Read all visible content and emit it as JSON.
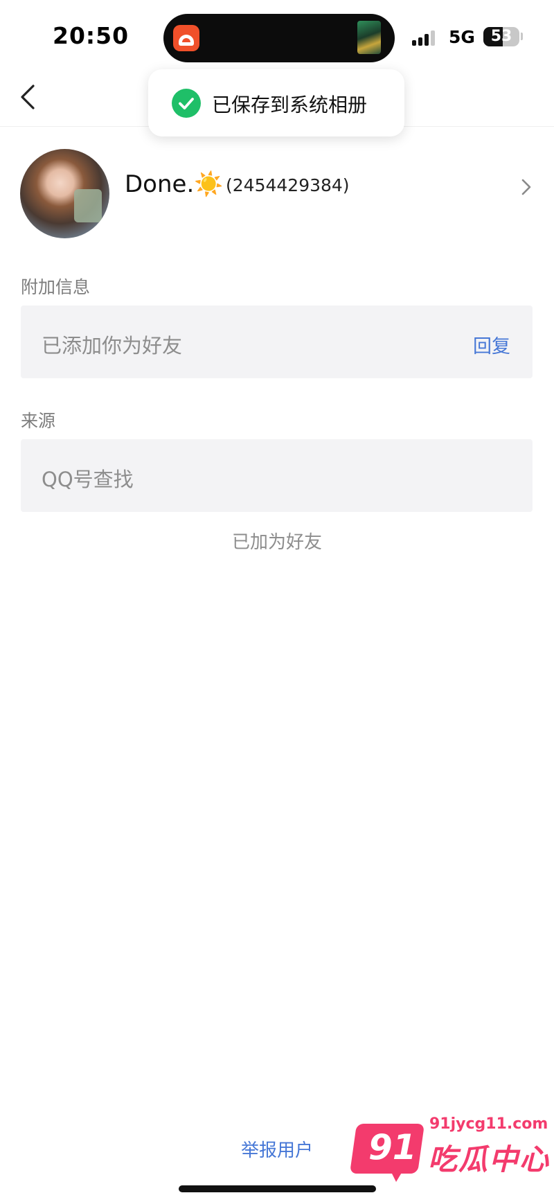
{
  "status_bar": {
    "time": "20:50",
    "network": "5G",
    "battery_level": 53,
    "battery_text": "53"
  },
  "toast": {
    "text": "已保存到系统相册",
    "icon": "check-circle-icon",
    "icon_color": "#1fbf68"
  },
  "profile": {
    "nickname": "Done.☀️",
    "qq_number": "(2454429384)"
  },
  "extra_info": {
    "label": "附加信息",
    "message": "已添加你为好友",
    "reply_label": "回复"
  },
  "source": {
    "label": "来源",
    "value": "QQ号查找"
  },
  "status": {
    "text": "已加为好友"
  },
  "footer": {
    "report_label": "举报用户"
  },
  "watermark": {
    "number": "91",
    "url": "91jycg11.com",
    "name": "吃瓜中心"
  },
  "colors": {
    "accent_link": "#4677d6",
    "success_green": "#1fbf68",
    "watermark_pink": "#f33b6d"
  }
}
